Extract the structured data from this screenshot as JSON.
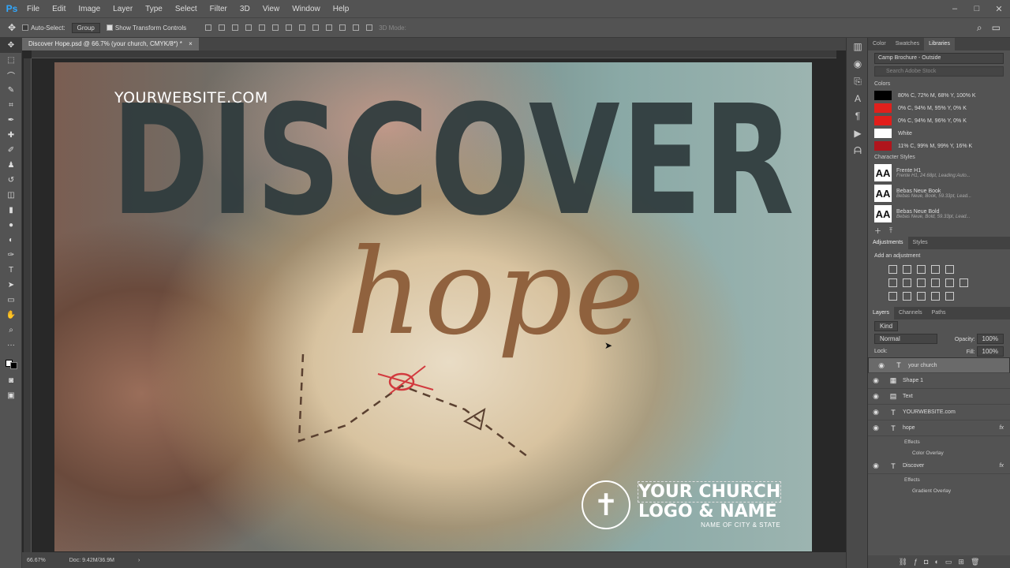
{
  "app": {
    "logo": "Ps"
  },
  "menu": [
    "File",
    "Edit",
    "Image",
    "Layer",
    "Type",
    "Select",
    "Filter",
    "3D",
    "View",
    "Window",
    "Help"
  ],
  "window_controls": [
    "–",
    "□",
    "✕"
  ],
  "options_bar": {
    "auto_select": "Auto-Select:",
    "auto_select_value": "Group",
    "show_transform": "Show Transform Controls",
    "mode_3d": "3D Mode:"
  },
  "document": {
    "tab": "Discover Hope.psd @ 66.7% (your church, CMYK/8*) *",
    "close": "×"
  },
  "status": {
    "zoom": "66.67%",
    "doc": "Doc: 9.42M/36.9M"
  },
  "artwork": {
    "website": "YOURWEBSITE.COM",
    "headline": "DISCOVER",
    "script": "hope",
    "church_line1": "YOUR CHURCH",
    "church_line2": "LOGO & NAME",
    "church_line3": "NAME OF CITY & STATE"
  },
  "libraries": {
    "tabs": [
      "Color",
      "Swatches",
      "Libraries"
    ],
    "library": "Camp Brochure - Outside",
    "search_placeholder": "Search Adobe Stock",
    "colors_heading": "Colors",
    "colors": [
      {
        "label": "80% C, 72% M, 68% Y, 100% K",
        "hex": "#000000"
      },
      {
        "label": "0% C, 94% M, 95% Y, 0% K",
        "hex": "#e0201c"
      },
      {
        "label": "0% C, 94% M, 96% Y, 0% K",
        "hex": "#e21d1a"
      },
      {
        "label": "White",
        "hex": "#ffffff"
      },
      {
        "label": "11% C, 99% M, 99% Y, 16% K",
        "hex": "#b0151c"
      }
    ],
    "char_heading": "Character Styles",
    "char_styles": [
      {
        "name": "Frente H1",
        "desc": "Frente H1, 24.68pt, Leading:Auto..."
      },
      {
        "name": "Bebas Neue Book",
        "desc": "Bebas Neue, Book, 59.33pt, Lead..."
      },
      {
        "name": "Bebas Neue Bold",
        "desc": "Bebas Neue, Bold, 59.33pt, Lead..."
      }
    ],
    "aa": "AA"
  },
  "adjustments": {
    "tabs": [
      "Adjustments",
      "Styles"
    ],
    "hint": "Add an adjustment"
  },
  "layers": {
    "tabs": [
      "Layers",
      "Channels",
      "Paths"
    ],
    "kind": "Kind",
    "blend": "Normal",
    "opacity_label": "Opacity:",
    "opacity": "100%",
    "lock_label": "Lock:",
    "fill_label": "Fill:",
    "fill": "100%",
    "items": [
      {
        "kind": "T",
        "name": "your church",
        "fx": ""
      },
      {
        "kind": "▦",
        "name": "Shape 1",
        "fx": ""
      },
      {
        "kind": "▤",
        "name": "Text",
        "fx": ""
      },
      {
        "kind": "T",
        "name": "YOURWEBSITE.com",
        "fx": ""
      },
      {
        "kind": "T",
        "name": "hope",
        "fx": "fx"
      },
      {
        "kind": "T",
        "name": "Discover",
        "fx": "fx"
      }
    ],
    "effects_label": "Effects",
    "hope_effect": "Color Overlay",
    "discover_effect": "Gradient Overlay"
  },
  "colors": {
    "accent": "#31a8ff",
    "headline": "#2f3b3d",
    "script": "#8a5a36"
  }
}
